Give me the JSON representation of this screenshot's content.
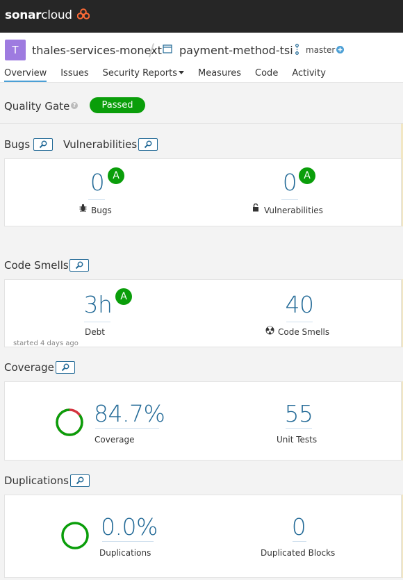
{
  "brand": {
    "logo_bold": "sonar",
    "logo_light": "cloud"
  },
  "header": {
    "org_initial": "T",
    "org_name": "thales-services-monext",
    "separator": "/",
    "project_name": "payment-method-tsi",
    "branch": "master"
  },
  "nav": {
    "items": [
      {
        "label": "Overview",
        "active": true
      },
      {
        "label": "Issues"
      },
      {
        "label": "Security Reports",
        "has_caret": true
      },
      {
        "label": "Measures"
      },
      {
        "label": "Code"
      },
      {
        "label": "Activity"
      }
    ]
  },
  "quality_gate": {
    "label": "Quality Gate",
    "help": "?",
    "status": "Passed"
  },
  "bugs_section": {
    "title_bugs": "Bugs",
    "title_vulnerabilities": "Vulnerabilities",
    "bugs": {
      "value": "0",
      "rating": "A",
      "label": "Bugs",
      "icon": "bug-icon"
    },
    "vulnerabilities": {
      "value": "0",
      "rating": "A",
      "label": "Vulnerabilities",
      "icon": "lock-icon"
    }
  },
  "code_smells_section": {
    "title": "Code Smells",
    "debt": {
      "value": "3h",
      "rating": "A",
      "label": "Debt"
    },
    "smells": {
      "value": "40",
      "label": "Code Smells",
      "icon": "radiation-icon"
    },
    "started": "started 4 days ago"
  },
  "coverage_section": {
    "title": "Coverage",
    "coverage": {
      "value": "84.7%",
      "label": "Coverage",
      "fraction": 0.847
    },
    "unit_tests": {
      "value": "55",
      "label": "Unit Tests"
    }
  },
  "duplications_section": {
    "title": "Duplications",
    "duplications": {
      "value": "0.0%",
      "label": "Duplications"
    },
    "blocks": {
      "value": "0",
      "label": "Duplicated Blocks"
    }
  },
  "colors": {
    "topbar": "#262626",
    "accent": "#236a97",
    "passed": "#0a9e0a",
    "rating_a": "#0a9e0a",
    "logo_icon": "#fd6a36",
    "coverage_uncovered": "#d4333f",
    "avatar": "#9e7be0"
  }
}
